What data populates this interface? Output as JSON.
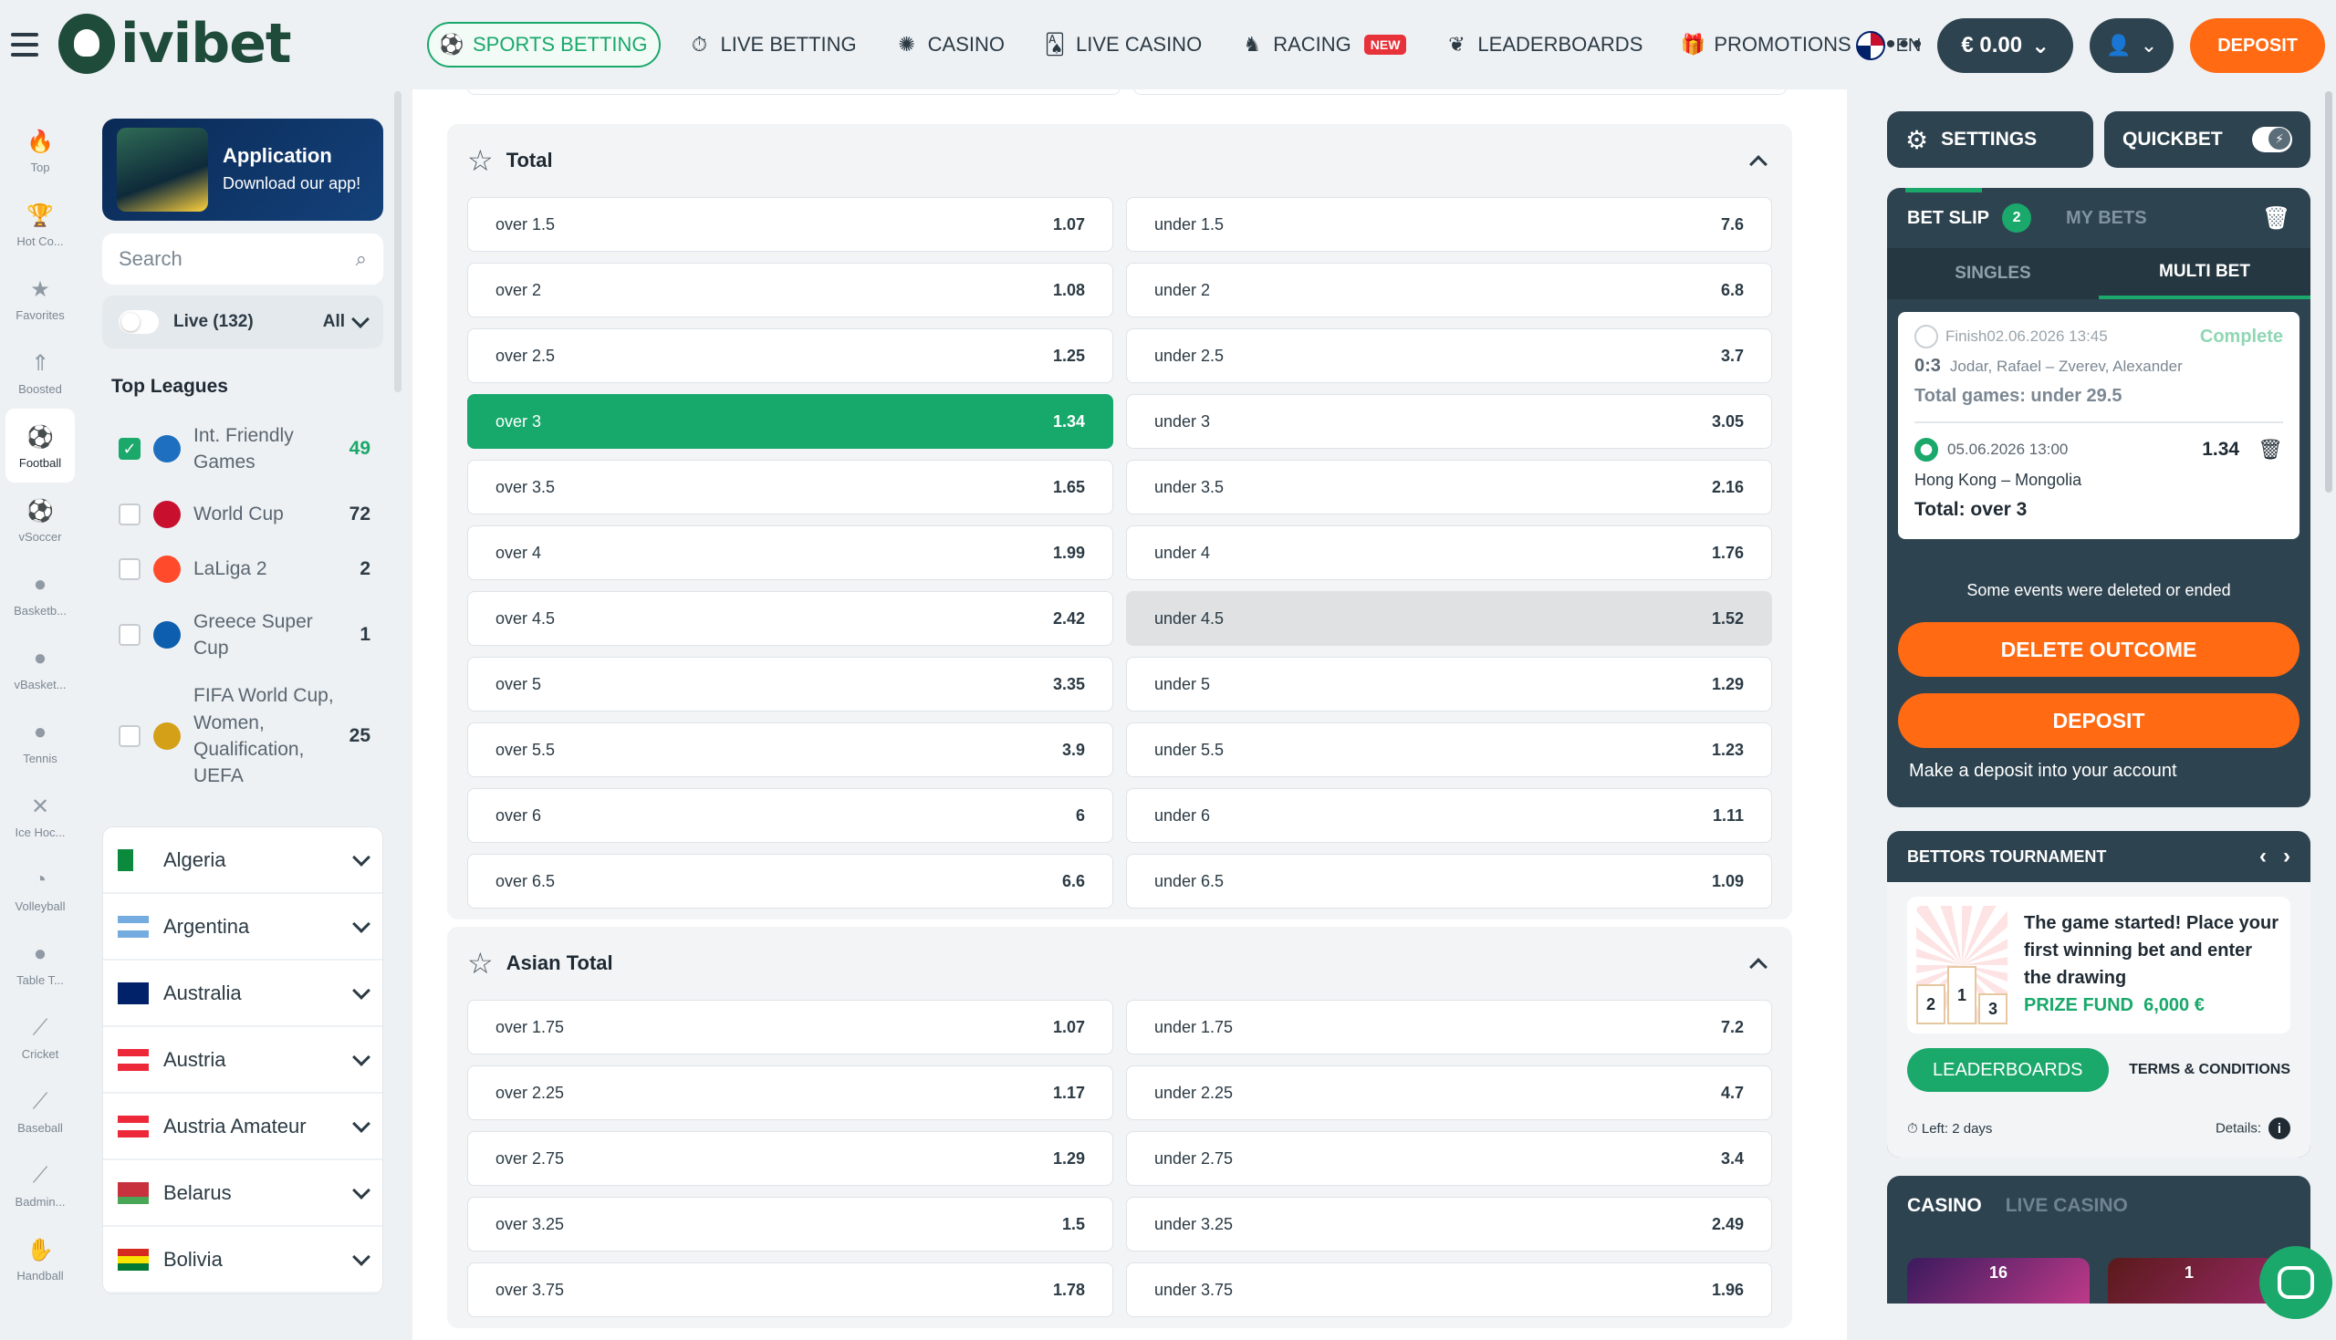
{
  "header": {
    "logo_text": "ivibet",
    "nav": [
      {
        "label": "SPORTS BETTING",
        "icon": "soccer-ball-icon",
        "glyph": "⚽",
        "active": true
      },
      {
        "label": "LIVE BETTING",
        "icon": "stopwatch-icon",
        "glyph": "⏱"
      },
      {
        "label": "CASINO",
        "icon": "casino-chip-icon",
        "glyph": "✺"
      },
      {
        "label": "LIVE CASINO",
        "icon": "cards-icon",
        "glyph": "🂡"
      },
      {
        "label": "RACING",
        "icon": "horse-icon",
        "glyph": "♞",
        "badge": "NEW"
      },
      {
        "label": "LEADERBOARDS",
        "icon": "laurel-icon",
        "glyph": "❦"
      },
      {
        "label": "PROMOTIONS",
        "icon": "gift-icon",
        "glyph": "🎁"
      }
    ],
    "more": "•••",
    "lang": "EN",
    "balance": "€ 0.00",
    "deposit": "DEPOSIT"
  },
  "rail": [
    {
      "label": "Top",
      "icon": "flame-icon",
      "glyph": "🔥"
    },
    {
      "label": "Hot Co...",
      "icon": "trophy-icon",
      "glyph": "🏆"
    },
    {
      "label": "Favorites",
      "icon": "star-icon",
      "glyph": "★"
    },
    {
      "label": "Boosted",
      "icon": "boost-icon",
      "glyph": "⇑"
    },
    {
      "label": "Football",
      "icon": "football-icon",
      "glyph": "⚽",
      "active": true
    },
    {
      "label": "vSoccer",
      "icon": "vsoccer-icon",
      "glyph": "⚽"
    },
    {
      "label": "Basketb...",
      "icon": "basketball-icon",
      "glyph": "●"
    },
    {
      "label": "vBasket...",
      "icon": "vbasketball-icon",
      "glyph": "●"
    },
    {
      "label": "Tennis",
      "icon": "tennis-icon",
      "glyph": "●"
    },
    {
      "label": "Ice Hoc...",
      "icon": "hockey-icon",
      "glyph": "✕"
    },
    {
      "label": "Volleyball",
      "icon": "volleyball-icon",
      "glyph": "◔"
    },
    {
      "label": "Table T...",
      "icon": "table-tennis-icon",
      "glyph": "●"
    },
    {
      "label": "Cricket",
      "icon": "cricket-icon",
      "glyph": "⟋"
    },
    {
      "label": "Baseball",
      "icon": "baseball-icon",
      "glyph": "⟋"
    },
    {
      "label": "Badmin...",
      "icon": "badminton-icon",
      "glyph": "⟋"
    },
    {
      "label": "Handball",
      "icon": "handball-icon",
      "glyph": "✋"
    }
  ],
  "sidebar": {
    "app_title": "Application",
    "app_sub": "Download our app!",
    "search_placeholder": "Search",
    "live_label": "Live (132)",
    "live_filter": "All",
    "top_leagues_title": "Top Leagues",
    "leagues": [
      {
        "name": "Int. Friendly Games",
        "count": "49",
        "checked": true
      },
      {
        "name": "World Cup",
        "count": "72"
      },
      {
        "name": "LaLiga 2",
        "count": "2"
      },
      {
        "name": "Greece Super Cup",
        "count": "1"
      },
      {
        "name": "FIFA World Cup, Women, Qualification, UEFA",
        "count": "25"
      }
    ],
    "countries": [
      {
        "name": "Algeria",
        "flag_colors": [
          "#0b8a3e",
          "#ffffff"
        ]
      },
      {
        "name": "Argentina",
        "flag_colors": [
          "#74acdf",
          "#ffffff",
          "#74acdf"
        ]
      },
      {
        "name": "Australia",
        "flag_colors": [
          "#012169",
          "#012169"
        ]
      },
      {
        "name": "Austria",
        "flag_colors": [
          "#ed2939",
          "#ffffff",
          "#ed2939"
        ]
      },
      {
        "name": "Austria Amateur",
        "flag_colors": [
          "#ed2939",
          "#ffffff",
          "#ed2939"
        ]
      },
      {
        "name": "Belarus",
        "flag_colors": [
          "#c8313e",
          "#c8313e",
          "#4aa657"
        ]
      },
      {
        "name": "Bolivia",
        "flag_colors": [
          "#d52b1e",
          "#f9e300",
          "#007934"
        ]
      }
    ]
  },
  "markets": {
    "total": {
      "title": "Total",
      "rows": [
        [
          {
            "l": "over 1.5",
            "v": "1.07"
          },
          {
            "l": "under 1.5",
            "v": "7.6"
          }
        ],
        [
          {
            "l": "over 2",
            "v": "1.08"
          },
          {
            "l": "under 2",
            "v": "6.8"
          }
        ],
        [
          {
            "l": "over 2.5",
            "v": "1.25"
          },
          {
            "l": "under 2.5",
            "v": "3.7"
          }
        ],
        [
          {
            "l": "over 3",
            "v": "1.34",
            "sel": true
          },
          {
            "l": "under 3",
            "v": "3.05"
          }
        ],
        [
          {
            "l": "over 3.5",
            "v": "1.65"
          },
          {
            "l": "under 3.5",
            "v": "2.16"
          }
        ],
        [
          {
            "l": "over 4",
            "v": "1.99"
          },
          {
            "l": "under 4",
            "v": "1.76"
          }
        ],
        [
          {
            "l": "over 4.5",
            "v": "2.42"
          },
          {
            "l": "under 4.5",
            "v": "1.52",
            "dim": true
          }
        ],
        [
          {
            "l": "over 5",
            "v": "3.35"
          },
          {
            "l": "under 5",
            "v": "1.29"
          }
        ],
        [
          {
            "l": "over 5.5",
            "v": "3.9"
          },
          {
            "l": "under 5.5",
            "v": "1.23"
          }
        ],
        [
          {
            "l": "over 6",
            "v": "6"
          },
          {
            "l": "under 6",
            "v": "1.11"
          }
        ],
        [
          {
            "l": "over 6.5",
            "v": "6.6"
          },
          {
            "l": "under 6.5",
            "v": "1.09"
          }
        ]
      ]
    },
    "asian": {
      "title": "Asian Total",
      "rows": [
        [
          {
            "l": "over 1.75",
            "v": "1.07"
          },
          {
            "l": "under 1.75",
            "v": "7.2"
          }
        ],
        [
          {
            "l": "over 2.25",
            "v": "1.17"
          },
          {
            "l": "under 2.25",
            "v": "4.7"
          }
        ],
        [
          {
            "l": "over 2.75",
            "v": "1.29"
          },
          {
            "l": "under 2.75",
            "v": "3.4"
          }
        ],
        [
          {
            "l": "over 3.25",
            "v": "1.5"
          },
          {
            "l": "under 3.25",
            "v": "2.49"
          }
        ],
        [
          {
            "l": "over 3.75",
            "v": "1.78"
          },
          {
            "l": "under 3.75",
            "v": "1.96"
          }
        ]
      ]
    }
  },
  "right": {
    "settings": "SETTINGS",
    "quickbet": "QUICKBET",
    "slip_title": "BET SLIP",
    "slip_count": "2",
    "my_bets": "MY BETS",
    "tab_singles": "SINGLES",
    "tab_multi": "MULTI BET",
    "bet1": {
      "status_time": "Finish02.06.2026 13:45",
      "status": "Complete",
      "score": "0:3",
      "teams": "Jodar, Rafael – Zverev, Alexander",
      "outcome": "Total games: under 29.5"
    },
    "bet2": {
      "time": "05.06.2026 13:00",
      "odd": "1.34",
      "teams": "Hong Kong – Mongolia",
      "outcome": "Total: over 3"
    },
    "deleted_msg": "Some events were deleted or ended",
    "delete_outcome": "DELETE OUTCOME",
    "deposit": "DEPOSIT",
    "deposit_note": "Make a deposit into your account",
    "tourney_title": "BETTORS TOURNAMENT",
    "tourney_text": "The game started! Place your first winning bet and enter the drawing",
    "prize_label": "PRIZE FUND",
    "prize_value": "6,000 €",
    "podium": [
      "2",
      "1",
      "3"
    ],
    "leaderboards": "LEADERBOARDS",
    "terms": "TERMS & CONDITIONS",
    "left_label": "Left:",
    "left_value": "2 days",
    "details": "Details:",
    "casino_tab": "CASINO",
    "live_casino_tab": "LIVE CASINO",
    "game_counts": [
      "16",
      "1"
    ]
  }
}
